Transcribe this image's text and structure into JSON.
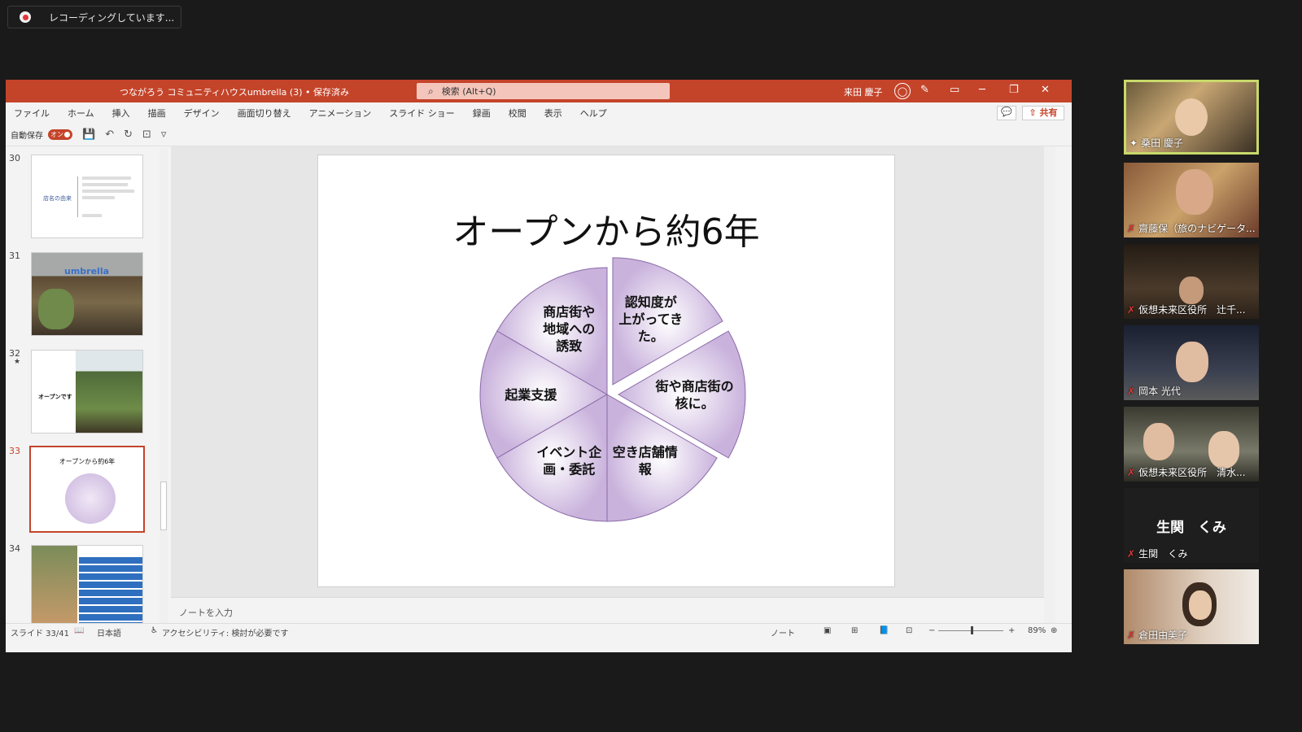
{
  "recording": {
    "label": "レコーディングしています..."
  },
  "window": {
    "title": "つながろう コミュニティハウスumbrella (3) • 保存済み",
    "search_placeholder": "検索 (Alt+Q)",
    "user": "来田 慶子",
    "share_label": "共有"
  },
  "ribbon_tabs": [
    "ファイル",
    "ホーム",
    "挿入",
    "描画",
    "デザイン",
    "画面切り替え",
    "アニメーション",
    "スライド ショー",
    "録画",
    "校閲",
    "表示",
    "ヘルプ"
  ],
  "qat": {
    "autosave_label": "自動保存",
    "toggle_label": "オン"
  },
  "thumbnails": [
    {
      "num": "30",
      "caption": "店名の由来"
    },
    {
      "num": "31",
      "caption": "umbrella"
    },
    {
      "num": "32",
      "caption": "オープンです"
    },
    {
      "num": "33",
      "caption": "オープンから約6年"
    },
    {
      "num": "34",
      "caption": ""
    }
  ],
  "slide": {
    "title": "オープンから約6年",
    "segments": [
      {
        "label": [
          "認知度が",
          "上がってき",
          "た。"
        ]
      },
      {
        "label": [
          "街や商店街の",
          "核に。"
        ]
      },
      {
        "label": [
          "空き店舗情",
          "報"
        ]
      },
      {
        "label": [
          "イベント企",
          "画・委託"
        ]
      },
      {
        "label": [
          "起業支援"
        ]
      },
      {
        "label": [
          "商店街や",
          "地域への",
          "誘致"
        ]
      }
    ],
    "fill_color": "#c9b2dc"
  },
  "notes_placeholder": "ノートを入力",
  "status": {
    "slide_count": "スライド 33/41",
    "language": "日本語",
    "accessibility": "アクセシビリティ: 検討が必要です",
    "notes": "ノート",
    "zoom": "89%"
  },
  "participants": [
    {
      "name": "桑田 慶子",
      "active": true,
      "muted": false
    },
    {
      "name": "齋藤保（旅のナビゲータ...",
      "active": false,
      "muted": true
    },
    {
      "name": "仮想未来区役所　辻千...",
      "active": false,
      "muted": true
    },
    {
      "name": "岡本 光代",
      "active": false,
      "muted": true
    },
    {
      "name": "仮想未来区役所　清水...",
      "active": false,
      "muted": true
    },
    {
      "name": "生関　くみ",
      "active": false,
      "muted": true,
      "display_name": "生関　くみ"
    },
    {
      "name": "倉田由美子",
      "active": false,
      "muted": true
    }
  ]
}
